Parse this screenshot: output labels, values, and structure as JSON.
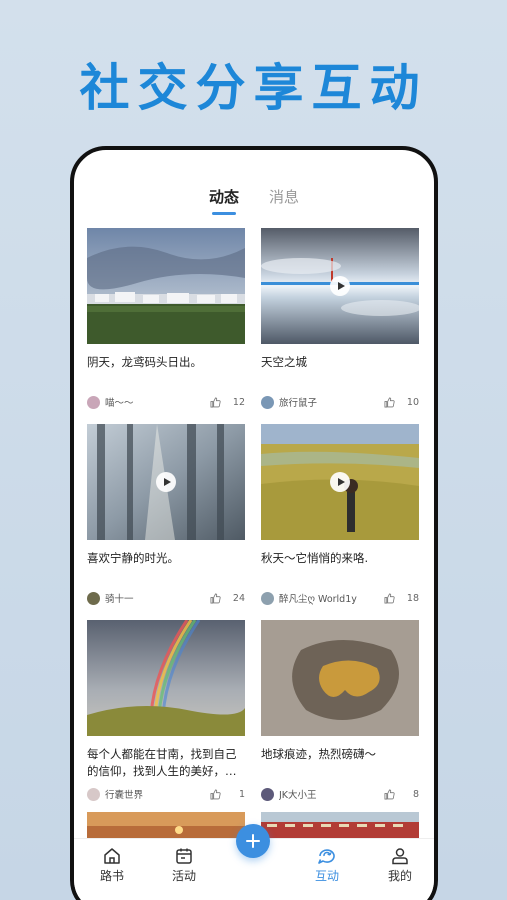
{
  "headline": "社交分享互动",
  "tabs": [
    {
      "label": "动态",
      "active": true
    },
    {
      "label": "消息",
      "active": false
    }
  ],
  "posts": [
    {
      "title": "阴天，龙鸢码头日出。",
      "user": "喵～～",
      "likes": "12",
      "video": false
    },
    {
      "title": "天空之城",
      "user": "旅行鼠子",
      "likes": "10",
      "video": true
    },
    {
      "title": "喜欢宁静的时光。",
      "user": "骑十一",
      "likes": "24",
      "video": true
    },
    {
      "title": "秋天～它悄悄的来咯.",
      "user": "醉凡尘ღ World1y",
      "likes": "18",
      "video": true
    },
    {
      "title": "每个人都能在甘南，找到自己的信仰，找到人生的美好，…",
      "user": "行囊世界",
      "likes": "1",
      "video": false
    },
    {
      "title": "地球痕迹，热烈磅礴～",
      "user": "JK大小王",
      "likes": "8",
      "video": false
    }
  ],
  "nav": [
    {
      "label": "路书",
      "icon": "home-icon",
      "active": false
    },
    {
      "label": "活动",
      "icon": "calendar-icon",
      "active": false
    },
    {
      "label": "互动",
      "icon": "chat-refresh-icon",
      "active": true
    },
    {
      "label": "我的",
      "icon": "person-icon",
      "active": false
    }
  ],
  "colors": {
    "accent": "#3c8fe0",
    "headline": "#1d87d8"
  }
}
